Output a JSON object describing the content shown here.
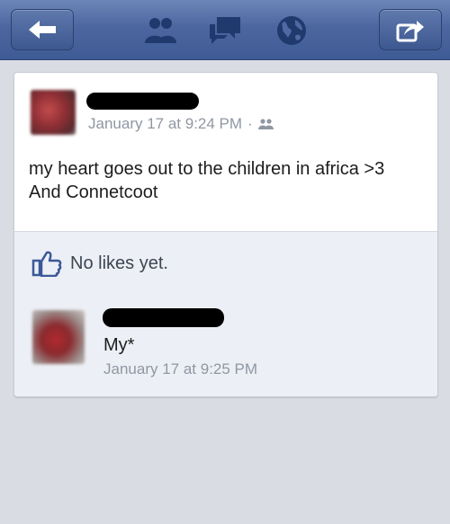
{
  "navbar": {
    "back_icon": "back-arrow-icon",
    "friends_icon": "friend-requests-icon",
    "messages_icon": "messages-icon",
    "notifications_icon": "globe-notifications-icon",
    "share_icon": "share-icon"
  },
  "post": {
    "timestamp": "January 17 at 9:24 PM",
    "separator": "·",
    "audience_icon": "friends-audience-icon",
    "text_line1": "my heart goes out to the children in africa >3",
    "text_line2": "And Connetcoot"
  },
  "likes": {
    "label": "No likes yet.",
    "icon": "thumbs-up-icon"
  },
  "comment": {
    "text": "My*",
    "timestamp": "January 17 at 9:25 PM"
  },
  "colors": {
    "navbar": "#4c67a0",
    "link": "#3b5998",
    "muted_text": "#9097a3"
  }
}
